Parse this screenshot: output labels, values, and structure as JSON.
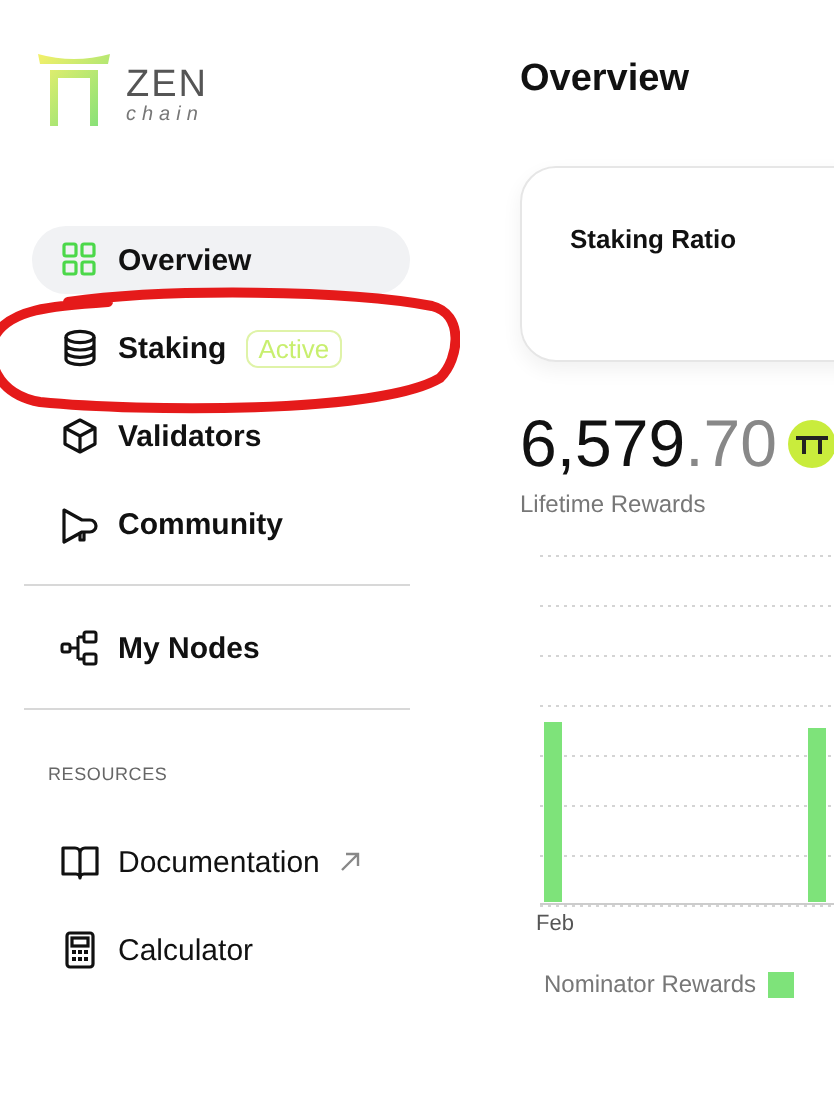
{
  "logo": {
    "name": "ZEN",
    "tagline": "chain"
  },
  "nav": [
    {
      "label": "Overview",
      "selected": true,
      "circled": false
    },
    {
      "label": "Staking",
      "selected": false,
      "circled": true,
      "badge": "Active"
    },
    {
      "label": "Validators",
      "selected": false,
      "circled": false
    },
    {
      "label": "Community",
      "selected": false,
      "circled": false
    }
  ],
  "nav_secondary": [
    {
      "label": "My Nodes",
      "selected": false
    }
  ],
  "resources": {
    "heading": "RESOURCES",
    "items": [
      {
        "label": "Documentation",
        "external": true
      },
      {
        "label": "Calculator",
        "external": false
      }
    ]
  },
  "page_title": "Overview",
  "card": {
    "title": "Staking Ratio"
  },
  "rewards": {
    "whole": "6,579",
    "fraction": ".70",
    "label": "Lifetime Rewards"
  },
  "chart": {
    "x_label": "Feb",
    "legend": [
      {
        "name": "Nominator Rewards",
        "color": "#7ee37a"
      }
    ]
  }
}
